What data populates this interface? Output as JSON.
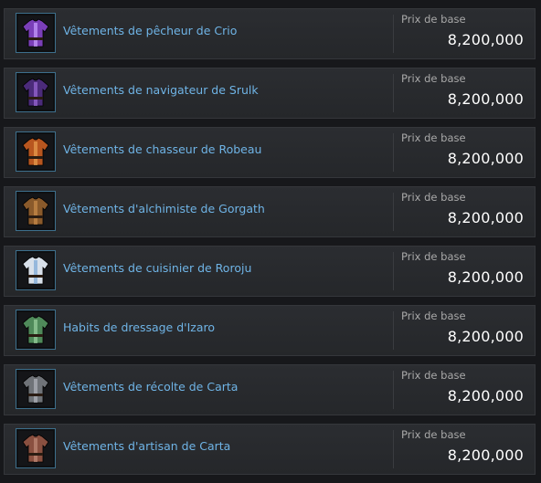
{
  "price_label": "Prix de base",
  "items": [
    {
      "name": "Vêtements de pêcheur de Crio",
      "price": "8,200,000",
      "icon": "purple-fisher-outfit-icon",
      "color": "#7a3fb8",
      "accent": "#c9a0ff"
    },
    {
      "name": "Vêtements de navigateur de Srulk",
      "price": "8,200,000",
      "icon": "purple-navigator-outfit-icon",
      "color": "#4b2b7a",
      "accent": "#9b6ad6"
    },
    {
      "name": "Vêtements de chasseur de Robeau",
      "price": "8,200,000",
      "icon": "orange-hunter-outfit-icon",
      "color": "#b8561f",
      "accent": "#e8a050"
    },
    {
      "name": "Vêtements d'alchimiste de Gorgath",
      "price": "8,200,000",
      "icon": "brown-alchemist-outfit-icon",
      "color": "#8a5a2b",
      "accent": "#c98b4b"
    },
    {
      "name": "Vêtements de cuisinier de Roroju",
      "price": "8,200,000",
      "icon": "white-cook-outfit-icon",
      "color": "#d8e0ea",
      "accent": "#7aa6d6"
    },
    {
      "name": "Habits de dressage d'Izaro",
      "price": "8,200,000",
      "icon": "green-training-outfit-icon",
      "color": "#4f8a5a",
      "accent": "#9bd29e"
    },
    {
      "name": "Vêtements de récolte de Carta",
      "price": "8,200,000",
      "icon": "gray-gathering-outfit-icon",
      "color": "#6f7378",
      "accent": "#b0b4ba"
    },
    {
      "name": "Vêtements d'artisan de Carta",
      "price": "8,200,000",
      "icon": "brown-artisan-outfit-icon",
      "color": "#8a5040",
      "accent": "#c08a78"
    }
  ]
}
